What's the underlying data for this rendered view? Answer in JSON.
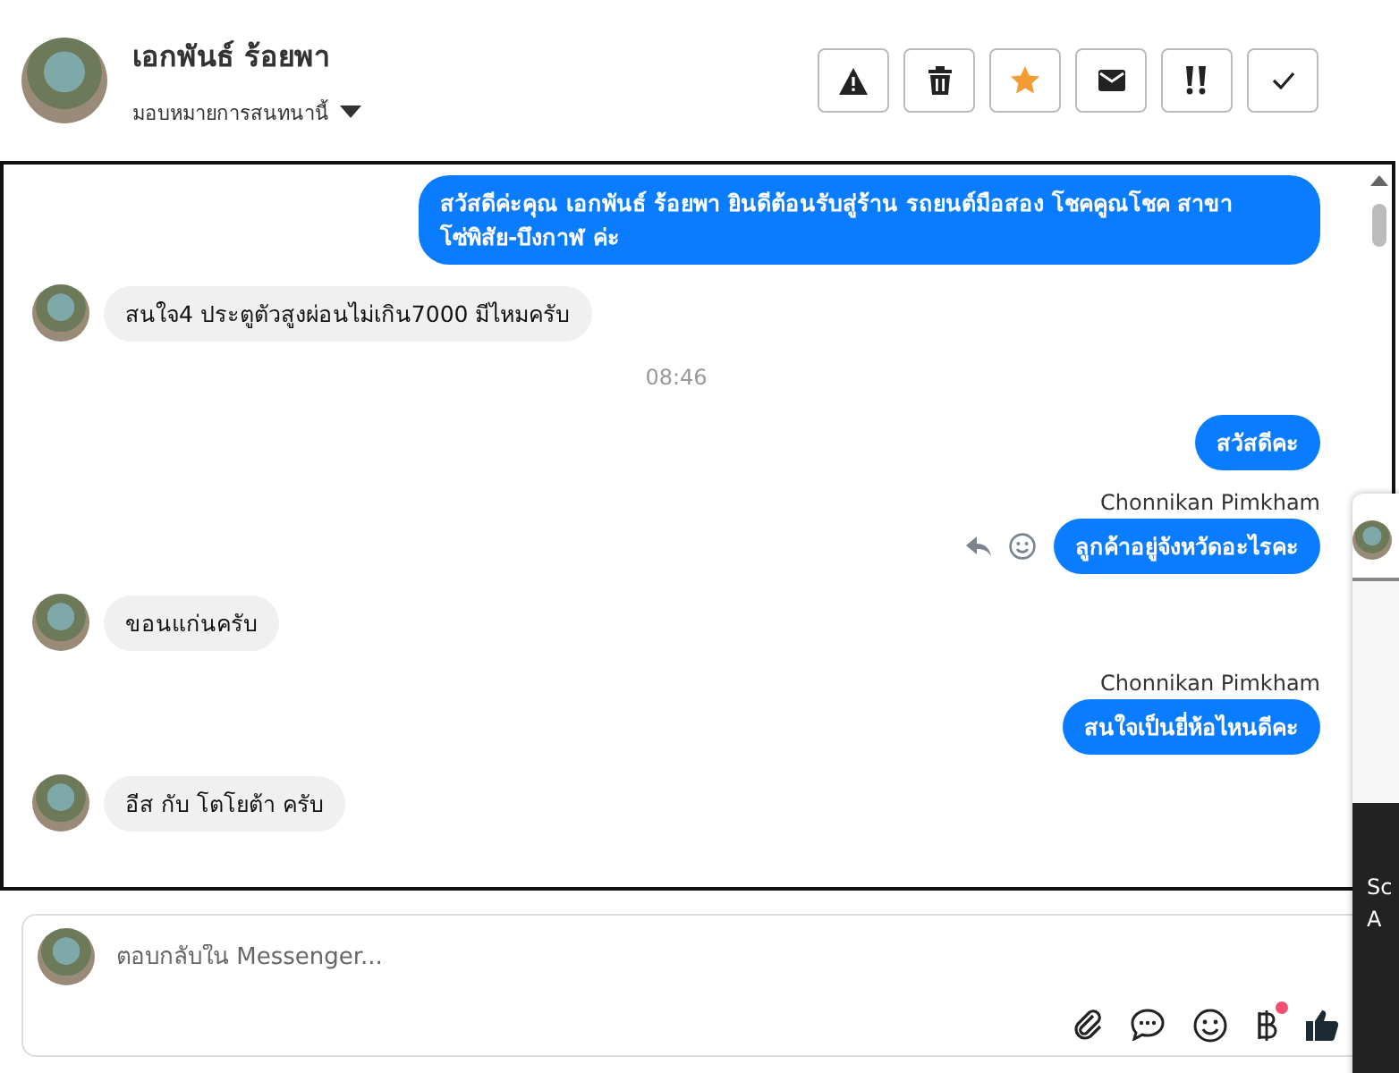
{
  "header": {
    "name": "เอกพันธ์ ร้อยพา",
    "assign_label": "มอบหมายการสนทนานี้"
  },
  "actions": [
    {
      "kind": "warning",
      "on": false
    },
    {
      "kind": "trash",
      "on": false
    },
    {
      "kind": "star",
      "on": true
    },
    {
      "kind": "mail",
      "on": false
    },
    {
      "kind": "important",
      "on": false
    },
    {
      "kind": "done",
      "on": false
    }
  ],
  "messages": [
    {
      "kind": "outgoing",
      "text": "สวัสดีค่ะคุณ เอกพันธ์ ร้อยพา ยินดีต้อนรับสู่ร้าน รถยนต์มือสอง โชคคูณโชค สาขา โซ่พิสัย-บึงกาฬ ค่ะ"
    },
    {
      "kind": "incoming",
      "text": "สนใจ4 ประตูตัวสูงผ่อนไม่เกิน7000 มีไหมครับ"
    },
    {
      "kind": "time",
      "text": "08:46"
    },
    {
      "kind": "outgoing",
      "text": "สวัสดีคะ"
    },
    {
      "kind": "outgoing",
      "sender": "Chonnikan Pimkham",
      "text": "ลูกค้าอยู่จังหวัดอะไรคะ",
      "hover_actions": true
    },
    {
      "kind": "incoming",
      "text": "ขอนแก่นครับ"
    },
    {
      "kind": "outgoing",
      "sender": "Chonnikan Pimkham",
      "text": "สนใจเป็นยี่ห้อไหนดีคะ"
    },
    {
      "kind": "incoming",
      "text": "อีส  กับ โตโยต้า  ครับ"
    }
  ],
  "composer": {
    "placeholder": "ตอบกลับใน Messenger...",
    "tools": [
      {
        "kind": "attach",
        "badge": false
      },
      {
        "kind": "chat",
        "badge": false
      },
      {
        "kind": "emoji",
        "badge": false
      },
      {
        "kind": "baht",
        "badge": true
      },
      {
        "kind": "like",
        "badge": false
      }
    ]
  },
  "side_panel": {
    "lines": [
      "Sc",
      "A"
    ]
  }
}
